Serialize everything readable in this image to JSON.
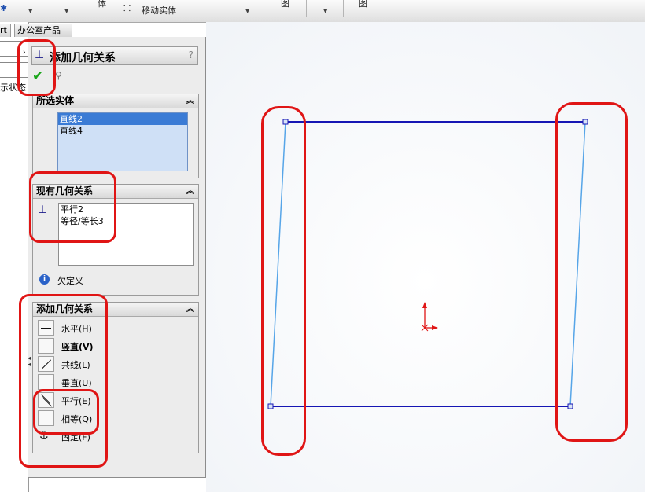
{
  "toolbar": {
    "items": [
      "体",
      "移动实体",
      "图",
      "图"
    ]
  },
  "left_tabs": [
    "rt",
    "办公室产品"
  ],
  "left_strip": {
    "partial_text": "示状态"
  },
  "panel": {
    "title": "添加几何关系",
    "help": "?",
    "selected_entities": {
      "header": "所选实体",
      "items": [
        "直线2",
        "直线4"
      ]
    },
    "existing_relations": {
      "header": "现有几何关系",
      "items": [
        "平行2",
        "等径/等长3"
      ],
      "status": "欠定义"
    },
    "add_relations": {
      "header": "添加几何关系",
      "buttons": [
        {
          "label": "水平(H)",
          "icon": "horizontal-icon"
        },
        {
          "label": "竖直(V)",
          "icon": "vertical-icon"
        },
        {
          "label": "共线(L)",
          "icon": "collinear-icon"
        },
        {
          "label": "垂直(U)",
          "icon": "perpendicular-icon"
        },
        {
          "label": "平行(E)",
          "icon": "parallel-icon"
        },
        {
          "label": "相等(Q)",
          "icon": "equal-icon"
        },
        {
          "label": "固定(F)",
          "icon": "fix-icon"
        }
      ]
    }
  },
  "colors": {
    "annotation": "#e01515",
    "sketch_line": "#1616b4",
    "selected_line": "#56a5e8",
    "selection_highlight": "#3a7bd5",
    "origin": "#e01515"
  }
}
